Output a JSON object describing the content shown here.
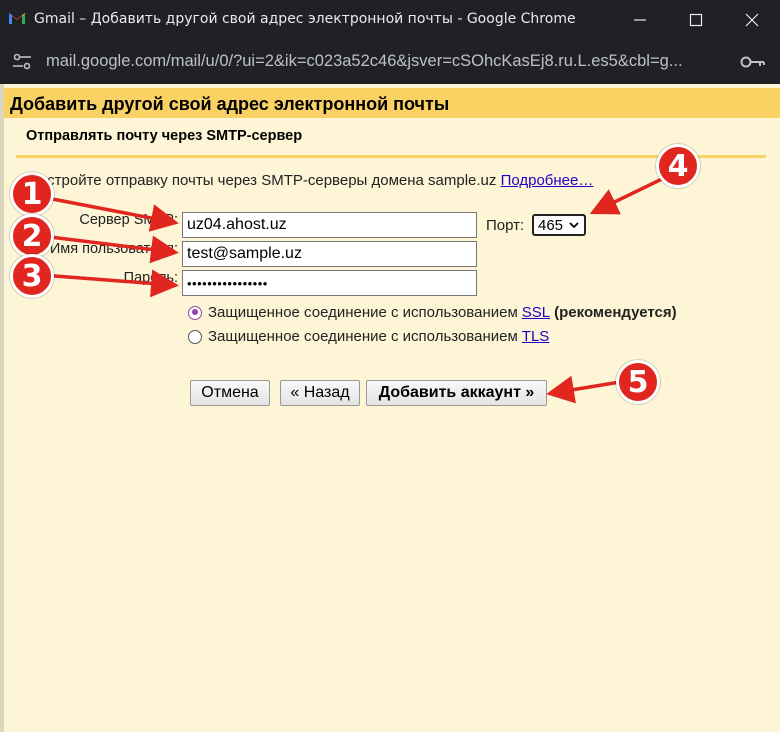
{
  "window": {
    "title": "Gmail – Добавить другой свой адрес электронной почты - Google Chrome"
  },
  "addressbar": {
    "url": "mail.google.com/mail/u/0/?ui=2&ik=c023a52c46&jsver=cSOhcKasEj8.ru.L.es5&cbl=g..."
  },
  "page": {
    "title": "Добавить другой свой адрес электронной почты",
    "section_title": "Отправлять почту через SMTP-сервер",
    "intro_text": "Настройте отправку почты через SMTP-серверы домена sample.uz",
    "intro_link": "Подробнее…"
  },
  "form": {
    "server_label": "Сервер SMTP:",
    "server_value": "uz04.ahost.uz",
    "port_label": "Порт:",
    "port_value": "465",
    "username_label": "Имя пользователя:",
    "username_value": "test@sample.uz",
    "password_label": "Пароль:",
    "password_value": "••••••••••••••••",
    "ssl_prefix": "Защищенное соединение с использованием",
    "ssl_link": "SSL",
    "ssl_suffix": "(рекомендуется)",
    "ssl_checked": true,
    "tls_prefix": "Защищенное соединение с использованием",
    "tls_link": "TLS",
    "tls_checked": false
  },
  "buttons": {
    "cancel": "Отмена",
    "back": "« Назад",
    "add": "Добавить аккаунт »"
  },
  "annotations": {
    "badges": [
      "1",
      "2",
      "3",
      "4",
      "5"
    ],
    "color": "#e0261f"
  },
  "colors": {
    "header": "#fad163",
    "page_bg": "#fdf5d6",
    "link": "#2200cc"
  }
}
